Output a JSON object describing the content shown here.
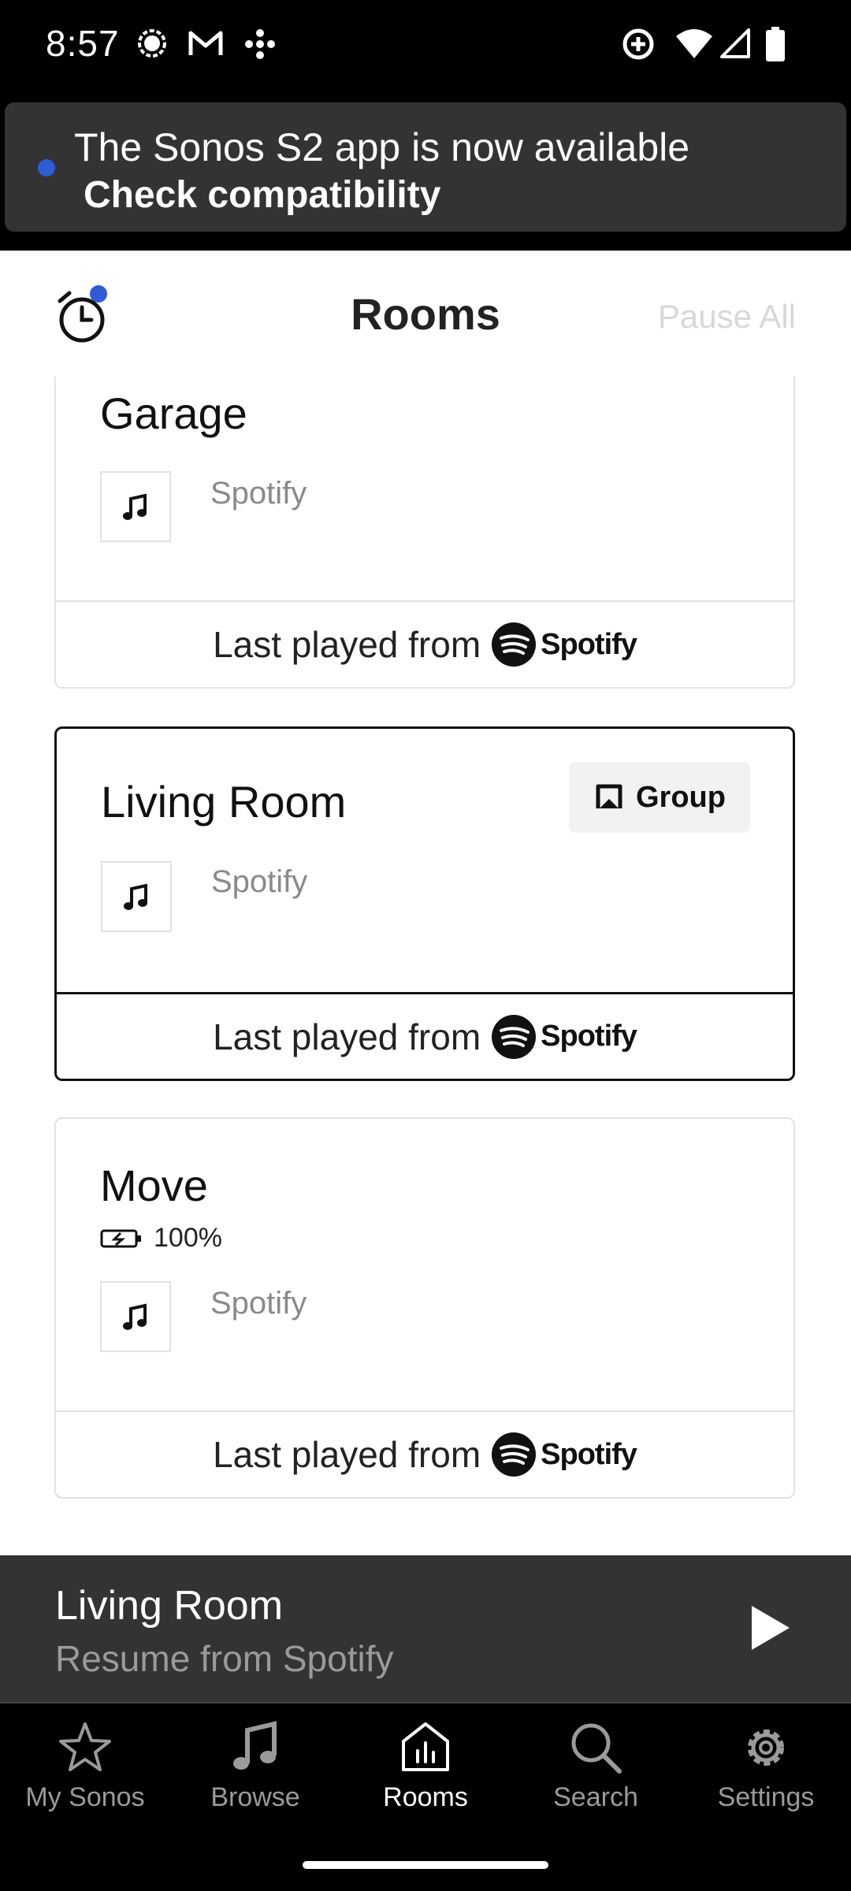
{
  "status_bar": {
    "time": "8:57"
  },
  "banner": {
    "message": "The Sonos S2 app is now available",
    "link": "Check compatibility"
  },
  "header": {
    "title": "Rooms",
    "pause_all": "Pause All"
  },
  "rooms": [
    {
      "name": "Garage",
      "source": "Spotify",
      "last_played_label": "Last played from",
      "service": "Spotify"
    },
    {
      "name": "Living Room",
      "source": "Spotify",
      "group_label": "Group",
      "last_played_label": "Last played from",
      "service": "Spotify",
      "selected": true
    },
    {
      "name": "Move",
      "battery": "100%",
      "source": "Spotify",
      "last_played_label": "Last played from",
      "service": "Spotify"
    }
  ],
  "mini_player": {
    "room": "Living Room",
    "subtitle": "Resume from Spotify"
  },
  "nav": [
    {
      "label": "My Sonos",
      "icon": "star-icon"
    },
    {
      "label": "Browse",
      "icon": "music-note-icon"
    },
    {
      "label": "Rooms",
      "icon": "rooms-icon",
      "active": true
    },
    {
      "label": "Search",
      "icon": "search-icon"
    },
    {
      "label": "Settings",
      "icon": "gear-icon"
    }
  ],
  "colors": {
    "accent_dot": "#2f5bd6",
    "dark_bg": "#333333"
  }
}
